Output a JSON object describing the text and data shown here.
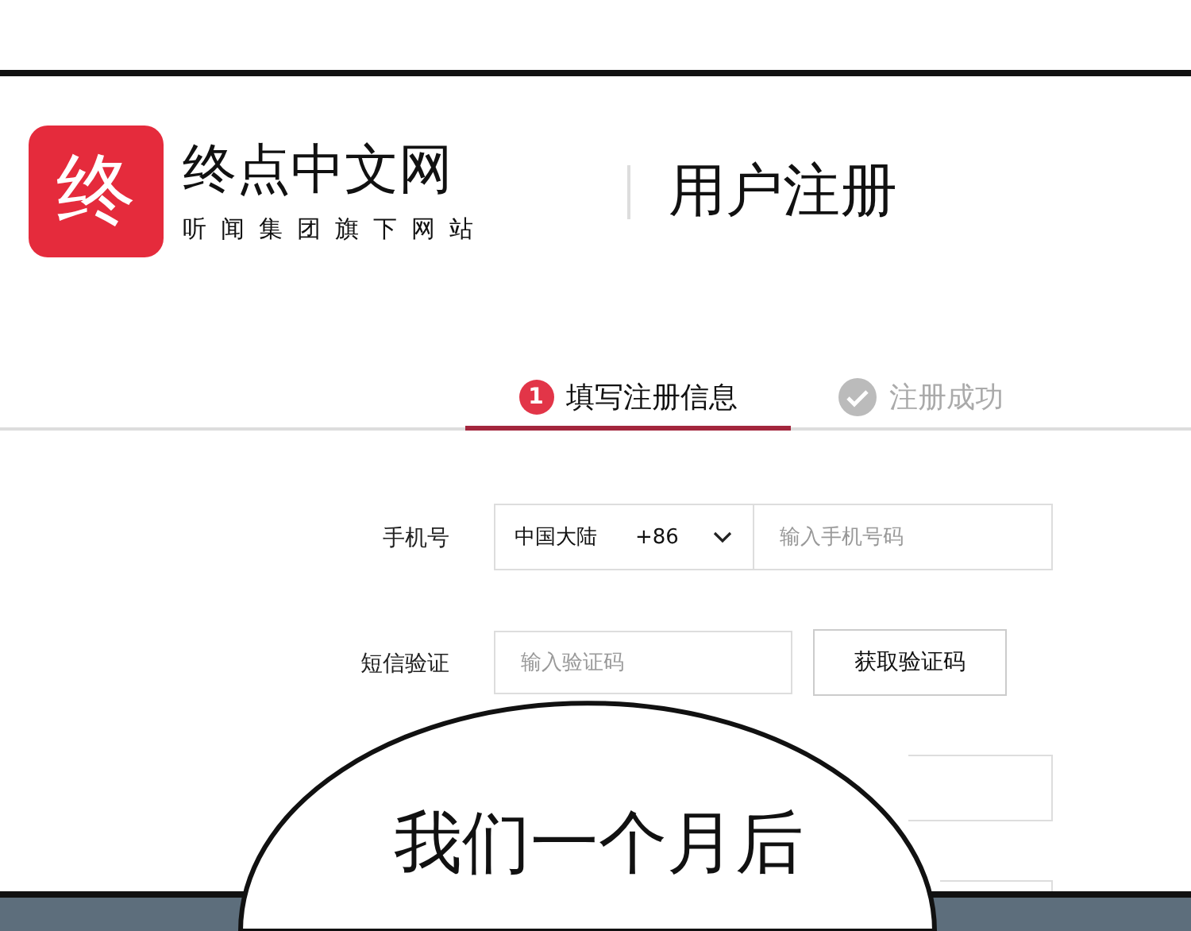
{
  "logo": {
    "mark": "终"
  },
  "brand": {
    "name": "终点中文网",
    "tagline": "听闻集团旗下网站"
  },
  "page_title": "用户注册",
  "steps": [
    {
      "kind": "number",
      "marker": "1",
      "label": "填写注册信息",
      "selected": true
    },
    {
      "kind": "done",
      "label": "注册成功",
      "selected": false
    }
  ],
  "form": {
    "phone": {
      "label": "手机号",
      "region": "中国大陆",
      "code": "+86",
      "placeholder": "输入手机号码"
    },
    "sms": {
      "label": "短信验证",
      "placeholder": "输入验证码",
      "button": "获取验证码"
    }
  },
  "bubble": {
    "text": "我们一个月后"
  }
}
